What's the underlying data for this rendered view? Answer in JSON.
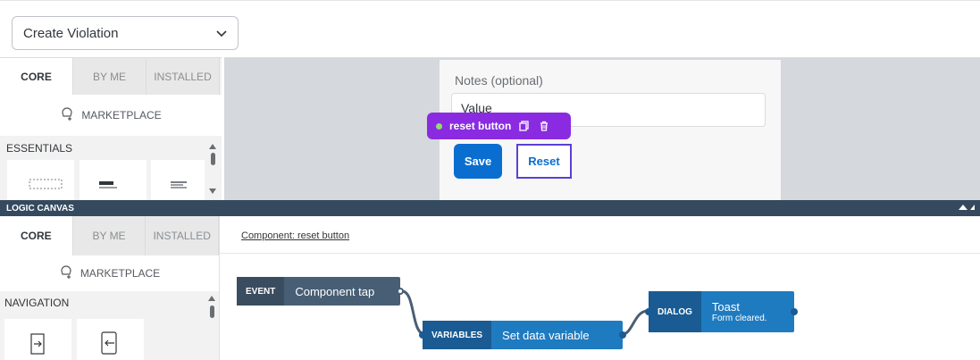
{
  "topbar": {
    "page_select_value": "Create Violation"
  },
  "upper_panel": {
    "tabs": [
      "CORE",
      "BY ME",
      "INSTALLED"
    ],
    "marketplace_label": "MARKETPLACE",
    "group_label": "ESSENTIALS"
  },
  "preview": {
    "notes_label": "Notes (optional)",
    "notes_value": "Value",
    "tooltip_label": "reset button",
    "save_label": "Save",
    "reset_label": "Reset"
  },
  "logic_bar": {
    "label": "LOGIC CANVAS"
  },
  "lower_panel": {
    "tabs": [
      "CORE",
      "BY ME",
      "INSTALLED"
    ],
    "marketplace_label": "MARKETPLACE",
    "group_label": "NAVIGATION"
  },
  "logic": {
    "breadcrumb": "Component: reset button",
    "nodes": [
      {
        "kind": "EVENT",
        "title": "Component tap"
      },
      {
        "kind": "VARIABLES",
        "title": "Set data variable"
      },
      {
        "kind": "DIALOG",
        "title": "Toast",
        "subtitle": "Form cleared."
      }
    ]
  },
  "colors": {
    "primary_blue": "#0a6ed1",
    "tooltip_purple": "#8a2be2",
    "logic_bar": "#354a5f",
    "event_node": "#475e75",
    "action_node": "#1f7bc0"
  },
  "icons": [
    "chevron-down-icon",
    "marketplace-icon",
    "copy-icon",
    "trash-icon",
    "collapse-icon",
    "open-page-icon",
    "navigate-back-icon"
  ]
}
